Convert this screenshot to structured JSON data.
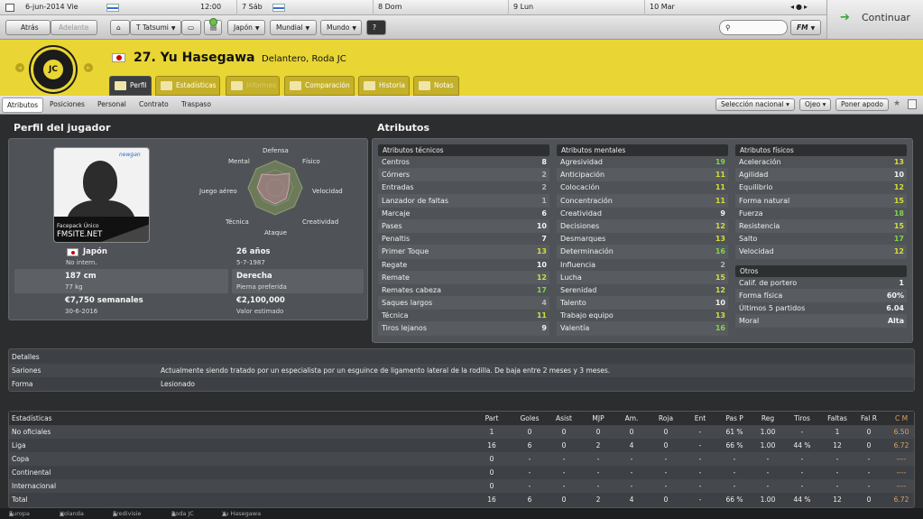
{
  "datebar": {
    "date": "6-jun-2014 Vie",
    "time": "12:00",
    "day1": "7 Sáb",
    "day2": "8 Dom",
    "day3": "9 Lun",
    "day4": "10 Mar"
  },
  "nav": {
    "back": "Atrás",
    "forward": "Adelante",
    "manager": "T Tatsumi",
    "japan": "Japón",
    "world_cup": "Mundial",
    "world": "Mundo",
    "continue": "Continuar",
    "fm": "FM"
  },
  "player": {
    "number_name": "27. Yu Hasegawa",
    "role": "Delantero, Roda JC"
  },
  "tabs": [
    "Perfil",
    "Estadísticas",
    "Informes",
    "Comparación",
    "Historia",
    "Notas"
  ],
  "subtabs": [
    "Atributos",
    "Posiciones",
    "Personal",
    "Contrato",
    "Traspaso"
  ],
  "actions": {
    "national": "Selección nacional",
    "scout": "Ojeo",
    "set": "Poner apodo"
  },
  "profile": {
    "title": "Perfil del jugador",
    "photo_tag": "Facepack Único",
    "photo_site": "FMSITE.NET",
    "photo_logo": "newgan",
    "radar": [
      "Defensa",
      "Físico",
      "Velocidad",
      "Creatividad",
      "Ataque",
      "Técnica",
      "Juego aéreo",
      "Mental"
    ],
    "nation": "Japón",
    "caps": "No intern.",
    "age": "26 años",
    "dob": "5-7-1987",
    "height": "187 cm",
    "weight": "77 kg",
    "foot": "Derecha",
    "foot_label": "Pierna preferida",
    "wage": "€7,750 semanales",
    "wage_until": "30-6-2016",
    "value": "€2,100,000",
    "value_label": "Valor estimado"
  },
  "attributes_title": "Atributos",
  "technical": {
    "title": "Atributos técnicos",
    "rows": [
      [
        "Centros",
        "8",
        "w"
      ],
      [
        "Córners",
        "2",
        "g"
      ],
      [
        "Entradas",
        "2",
        "g"
      ],
      [
        "Lanzador de faltas",
        "1",
        "g"
      ],
      [
        "Marcaje",
        "6",
        "w"
      ],
      [
        "Pases",
        "10",
        "w"
      ],
      [
        "Penaltis",
        "7",
        "w"
      ],
      [
        "Primer Toque",
        "13",
        "y"
      ],
      [
        "Regate",
        "10",
        "w"
      ],
      [
        "Remate",
        "12",
        "y"
      ],
      [
        "Remates cabeza",
        "17",
        "l"
      ],
      [
        "Saques largos",
        "4",
        "g"
      ],
      [
        "Técnica",
        "11",
        "y"
      ],
      [
        "Tiros lejanos",
        "9",
        "w"
      ]
    ]
  },
  "mental": {
    "title": "Atributos mentales",
    "rows": [
      [
        "Agresividad",
        "19",
        "l"
      ],
      [
        "Anticipación",
        "11",
        "y"
      ],
      [
        "Colocación",
        "11",
        "y"
      ],
      [
        "Concentración",
        "11",
        "y"
      ],
      [
        "Creatividad",
        "9",
        "w"
      ],
      [
        "Decisiones",
        "12",
        "y"
      ],
      [
        "Desmarques",
        "13",
        "y"
      ],
      [
        "Determinación",
        "16",
        "l"
      ],
      [
        "Influencia",
        "2",
        "g"
      ],
      [
        "Lucha",
        "15",
        "y"
      ],
      [
        "Serenidad",
        "12",
        "y"
      ],
      [
        "Talento",
        "10",
        "w"
      ],
      [
        "Trabajo equipo",
        "13",
        "y"
      ],
      [
        "Valentía",
        "16",
        "l"
      ]
    ]
  },
  "physical": {
    "title": "Atributos físicos",
    "rows": [
      [
        "Aceleración",
        "13",
        "y"
      ],
      [
        "Agilidad",
        "10",
        "w"
      ],
      [
        "Equilibrio",
        "12",
        "y"
      ],
      [
        "Forma natural",
        "15",
        "y"
      ],
      [
        "Fuerza",
        "18",
        "l"
      ],
      [
        "Resistencia",
        "15",
        "y"
      ],
      [
        "Salto",
        "17",
        "l"
      ],
      [
        "Velocidad",
        "12",
        "y"
      ]
    ]
  },
  "others": {
    "title": "Otros",
    "rows": [
      [
        "Calif. de portero",
        "1"
      ],
      [
        "Forma física",
        "60%"
      ],
      [
        "Últimos 5 partidos",
        "6.04"
      ],
      [
        "Moral",
        "Alta"
      ]
    ]
  },
  "details": {
    "title": "Detalles",
    "injury_label": "Sariones",
    "injury_text": "Actualmente siendo tratado por un especialista por un esguince de ligamento lateral de la rodilla. De baja entre 2 meses y 3 meses.",
    "form_label": "Forma",
    "form_value": "Lesionado"
  },
  "stats": {
    "headers": [
      "Estadísticas",
      "Part",
      "Goles",
      "Asist",
      "MJP",
      "Am.",
      "Roja",
      "Ent",
      "Pas P",
      "Reg",
      "Tiros",
      "Faltas",
      "Fal R",
      "C M"
    ],
    "rows": [
      [
        "No oficiales",
        "1",
        "0",
        "0",
        "0",
        "0",
        "0",
        "-",
        "61 %",
        "1.00",
        "-",
        "1",
        "0",
        "6.50"
      ],
      [
        "Liga",
        "16",
        "6",
        "0",
        "2",
        "4",
        "0",
        "-",
        "66 %",
        "1.00",
        "44 %",
        "12",
        "0",
        "6.72"
      ],
      [
        "Copa",
        "0",
        "-",
        "-",
        "-",
        "-",
        "-",
        "-",
        "-",
        "-",
        "-",
        "-",
        "-",
        "----"
      ],
      [
        "Continental",
        "0",
        "-",
        "-",
        "-",
        "-",
        "-",
        "-",
        "-",
        "-",
        "-",
        "-",
        "-",
        "----"
      ],
      [
        "Internacional",
        "0",
        "-",
        "-",
        "-",
        "-",
        "-",
        "-",
        "-",
        "-",
        "-",
        "-",
        "-",
        "----"
      ],
      [
        "Total",
        "16",
        "6",
        "0",
        "2",
        "4",
        "0",
        "-",
        "66 %",
        "1.00",
        "44 %",
        "12",
        "0",
        "6.72"
      ]
    ]
  },
  "crumb": [
    "Europa",
    "Holanda",
    "Eredivisie",
    "Roda JC",
    "Yu Hasegawa"
  ],
  "colors": {
    "header_yellow": "#e9d534",
    "attr_green": "#7fd54a",
    "attr_yellow": "#d6dd35",
    "rating_orange": "#e0a060"
  }
}
